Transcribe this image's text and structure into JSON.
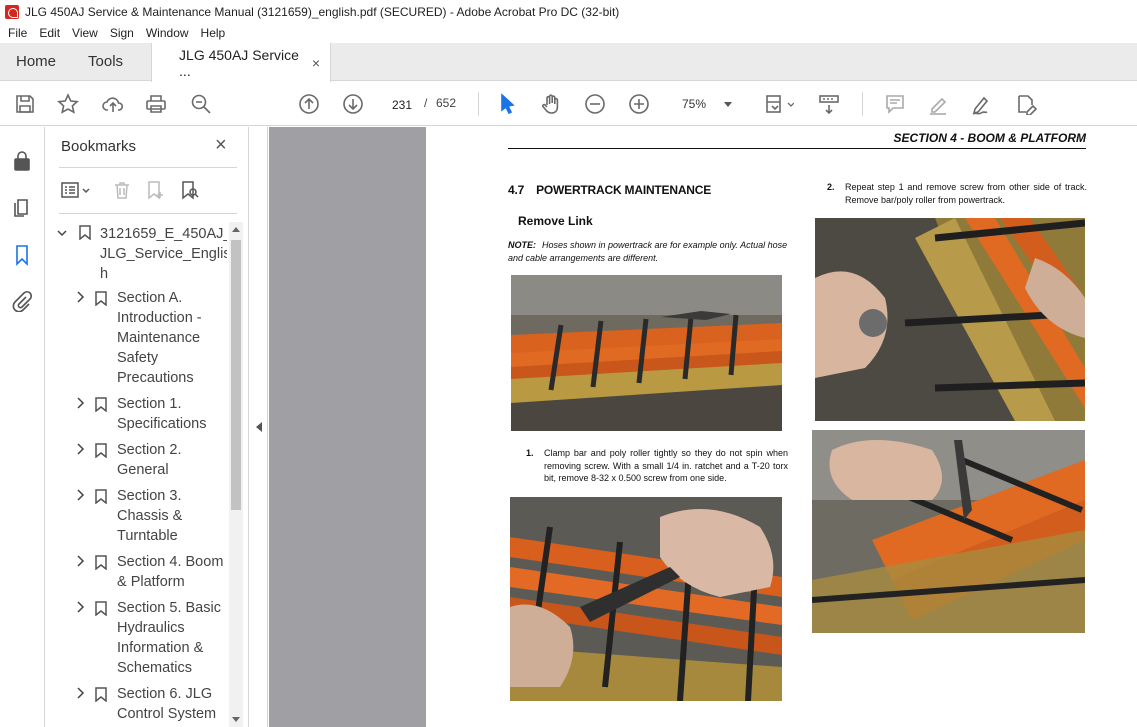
{
  "window": {
    "title": "JLG 450AJ Service & Maintenance Manual (3121659)_english.pdf (SECURED) - Adobe Acrobat Pro DC (32-bit)"
  },
  "menu": [
    "File",
    "Edit",
    "View",
    "Sign",
    "Window",
    "Help"
  ],
  "tabs": {
    "home": "Home",
    "tools": "Tools",
    "document": "JLG 450AJ Service ...",
    "close": "×"
  },
  "toolbar": {
    "current_page": "231",
    "page_separator": "/",
    "total_pages": "652",
    "zoom": "75%"
  },
  "bookmarks": {
    "title": "Bookmarks",
    "close": "×",
    "items": [
      {
        "label": "3121659_E_450AJ_ JLG_Service_Englis h"
      },
      {
        "label": "Section A. Introduction - Maintenance Safety Precautions"
      },
      {
        "label": "Section 1. Specifications"
      },
      {
        "label": "Section 2. General"
      },
      {
        "label": "Section 3. Chassis & Turntable"
      },
      {
        "label": "Section 4. Boom & Platform"
      },
      {
        "label": "Section 5. Basic Hydraulics Information & Schematics"
      },
      {
        "label": "Section 6. JLG Control System"
      }
    ]
  },
  "page": {
    "header": "SECTION 4 - BOOM & PLATFORM",
    "section_number": "4.7",
    "section_title": "POWERTRACK MAINTENANCE",
    "subheading": "Remove Link",
    "note_label": "NOTE:",
    "note_text": "Hoses shown in powertrack are for example only. Actual hose and cable arrangements are different.",
    "step1_num": "1.",
    "step1_text": "Clamp bar and poly roller tightly so they do not spin when removing screw. With a small 1/4 in. ratchet and a T-20 torx bit, remove 8-32 x 0.500 screw from one side.",
    "step2_num": "2.",
    "step2_text": "Repeat step 1 and remove screw from other side of track. Remove bar/poly roller from powertrack."
  }
}
